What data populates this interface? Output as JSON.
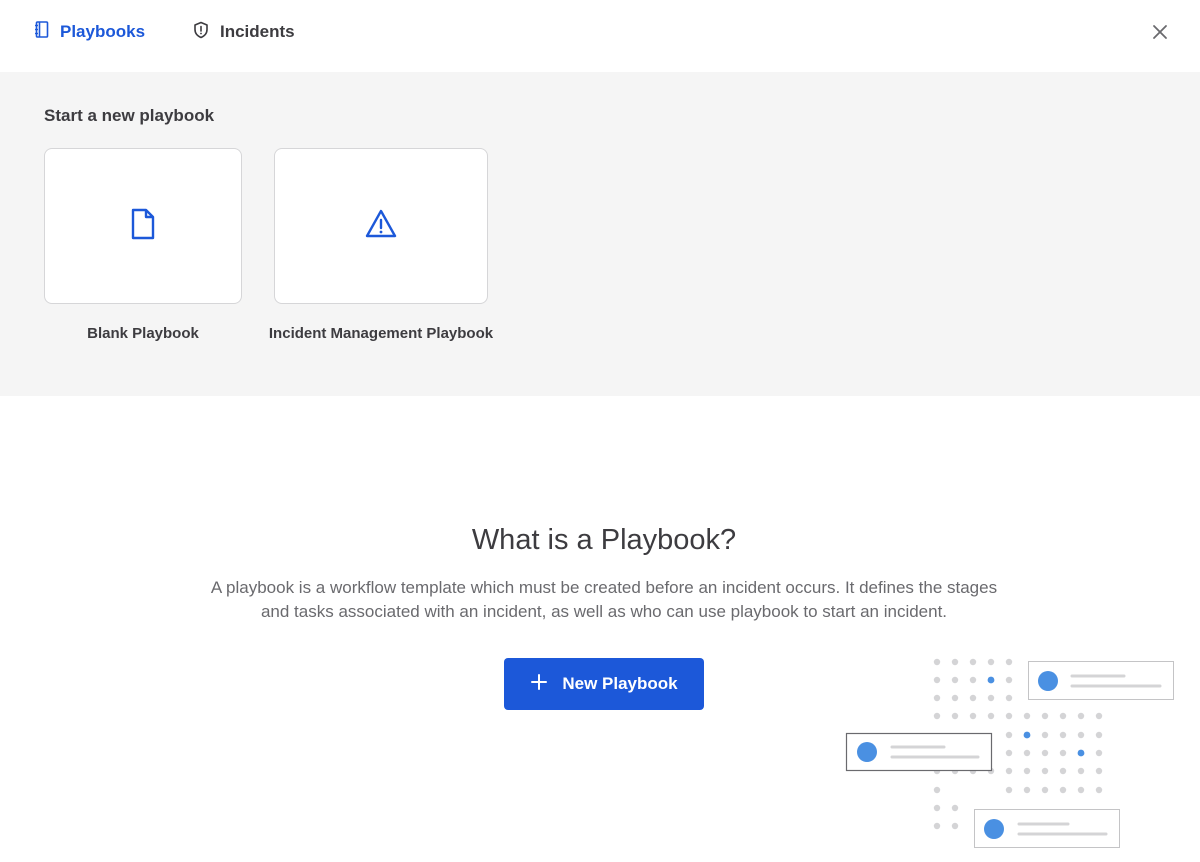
{
  "header": {
    "tabs": [
      {
        "label": "Playbooks",
        "icon": "book-icon",
        "active": true
      },
      {
        "label": "Incidents",
        "icon": "shield-icon",
        "active": false
      }
    ],
    "close_icon": "close-icon"
  },
  "templates": {
    "title": "Start a new playbook",
    "items": [
      {
        "label": "Blank Playbook",
        "icon": "document-icon"
      },
      {
        "label": "Incident Management Playbook",
        "icon": "warning-icon"
      }
    ]
  },
  "info": {
    "title": "What is a Playbook?",
    "description": "A playbook is a workflow template which must be created before an incident occurs. It defines the stages and tasks associated with an incident, as well as who can use playbook to start an incident.",
    "button_label": "New Playbook",
    "button_icon": "plus-icon"
  },
  "colors": {
    "accent": "#1c58d9",
    "illustration_accent": "#4a90e2",
    "section_background": "#f5f5f5"
  }
}
